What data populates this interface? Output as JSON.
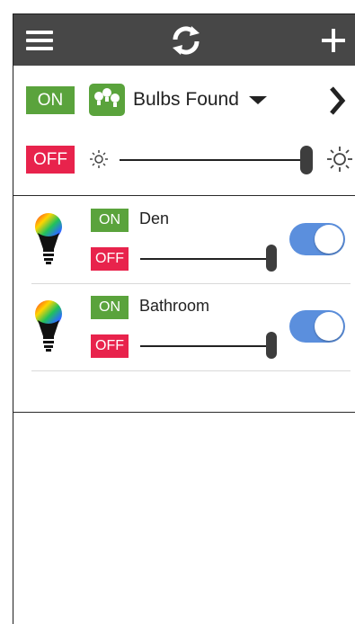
{
  "header": {
    "menu_icon": "hamburger-menu-icon",
    "refresh_icon": "refresh-icon",
    "add_icon": "plus-icon",
    "background": "#474747"
  },
  "group": {
    "on_label": "ON",
    "off_label": "OFF",
    "selector_label": "Bulbs Found",
    "selector_icon": "bulbs-group-icon",
    "next_icon": "chevron-right-icon",
    "brightness_min_icon": "sun-small-icon",
    "brightness_max_icon": "sun-large-icon",
    "brightness_level": 1.0
  },
  "bulbs": [
    {
      "name": "Den",
      "on_label": "ON",
      "off_label": "OFF",
      "brightness_level": 1.0,
      "power": true
    },
    {
      "name": "Bathroom",
      "on_label": "ON",
      "off_label": "OFF",
      "brightness_level": 1.0,
      "power": true
    }
  ],
  "colors": {
    "on_green": "#5aa33c",
    "off_red": "#e8234c",
    "toggle_blue": "#5b8fdd"
  }
}
